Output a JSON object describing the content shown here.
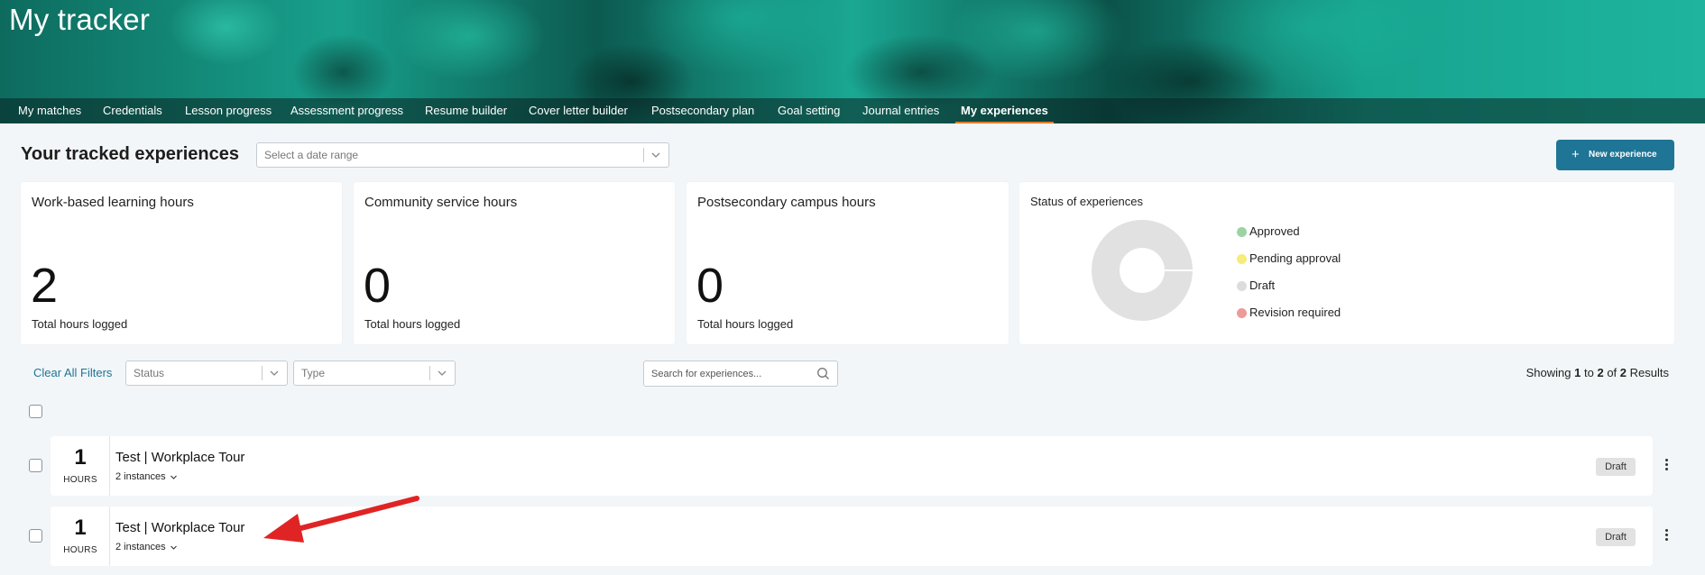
{
  "banner": {
    "title": "My tracker"
  },
  "tabs": [
    {
      "label": "My matches"
    },
    {
      "label": "Credentials"
    },
    {
      "label": "Lesson progress"
    },
    {
      "label": "Assessment progress"
    },
    {
      "label": "Resume builder"
    },
    {
      "label": "Cover letter builder"
    },
    {
      "label": "Postsecondary plan"
    },
    {
      "label": "Goal setting"
    },
    {
      "label": "Journal entries"
    },
    {
      "label": "My experiences",
      "active": true
    }
  ],
  "header": {
    "title": "Your tracked experiences",
    "date_placeholder": "Select a date range",
    "new_button_label": "New experience",
    "new_button_color": "#1e7596"
  },
  "stats": [
    {
      "title": "Work-based learning hours",
      "value": "2",
      "caption": "Total hours logged"
    },
    {
      "title": "Community service hours",
      "value": "0",
      "caption": "Total hours logged"
    },
    {
      "title": "Postsecondary campus hours",
      "value": "0",
      "caption": "Total hours logged"
    }
  ],
  "status_card": {
    "title": "Status of experiences",
    "legend": [
      {
        "label": "Approved",
        "color": "#9cd3a4"
      },
      {
        "label": "Pending approval",
        "color": "#f5ec7a"
      },
      {
        "label": "Draft",
        "color": "#dcdcdc"
      },
      {
        "label": "Revision required",
        "color": "#ec9a9a"
      }
    ]
  },
  "filters": {
    "clear_label": "Clear All Filters",
    "status_placeholder": "Status",
    "type_placeholder": "Type",
    "search_placeholder": "Search for experiences...",
    "results": {
      "prefix": "Showing",
      "from": "1",
      "to_word": "to",
      "to": "2",
      "of_word": "of",
      "total": "2",
      "suffix": "Results"
    }
  },
  "experiences": [
    {
      "hours": "1",
      "hours_label": "HOURS",
      "title": "Test | Workplace Tour",
      "instances": "2 instances",
      "status": "Draft"
    },
    {
      "hours": "1",
      "hours_label": "HOURS",
      "title": "Test | Workplace Tour",
      "instances": "2 instances",
      "status": "Draft"
    }
  ],
  "annotation": {
    "arrow_color": "#e02424"
  }
}
